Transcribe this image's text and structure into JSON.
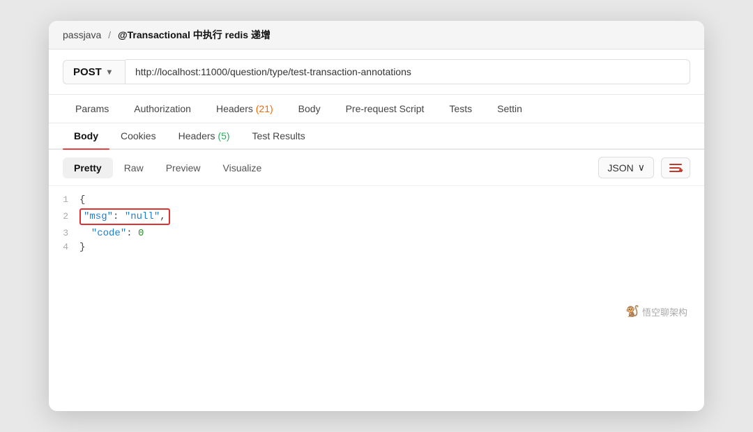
{
  "titlebar": {
    "breadcrumb_base": "passjava",
    "separator": "/",
    "breadcrumb_title": "@Transactional 中执行 redis 递增"
  },
  "url_bar": {
    "method": "POST",
    "chevron": "▾",
    "url": "http://localhost:11000/question/type/test-transaction-annotations"
  },
  "tabs": [
    {
      "id": "params",
      "label": "Params",
      "badge": null,
      "active": false
    },
    {
      "id": "authorization",
      "label": "Authorization",
      "badge": null,
      "active": false
    },
    {
      "id": "headers",
      "label": "Headers",
      "badge": "(21)",
      "active": false
    },
    {
      "id": "body",
      "label": "Body",
      "badge": null,
      "active": false
    },
    {
      "id": "pre-request",
      "label": "Pre-request Script",
      "badge": null,
      "active": false
    },
    {
      "id": "tests",
      "label": "Tests",
      "badge": null,
      "active": false
    },
    {
      "id": "settings",
      "label": "Settin",
      "badge": null,
      "active": false
    }
  ],
  "sub_tabs": [
    {
      "id": "body",
      "label": "Body",
      "badge": null,
      "active": true
    },
    {
      "id": "cookies",
      "label": "Cookies",
      "badge": null,
      "active": false
    },
    {
      "id": "headers",
      "label": "Headers",
      "badge": "(5)",
      "active": false
    },
    {
      "id": "test-results",
      "label": "Test Results",
      "badge": null,
      "active": false
    }
  ],
  "response_toolbar": {
    "tabs": [
      {
        "id": "pretty",
        "label": "Pretty",
        "active": true
      },
      {
        "id": "raw",
        "label": "Raw",
        "active": false
      },
      {
        "id": "preview",
        "label": "Preview",
        "active": false
      },
      {
        "id": "visualize",
        "label": "Visualize",
        "active": false
      }
    ],
    "format": "JSON",
    "format_chevron": "∨",
    "wrap_icon": "⇌"
  },
  "code_lines": [
    {
      "num": "1",
      "content_type": "brace_open"
    },
    {
      "num": "2",
      "content_type": "msg_line",
      "key": "\"msg\"",
      "colon": ":",
      "value": "\"null\"",
      "comma": ","
    },
    {
      "num": "3",
      "content_type": "code_line",
      "key": "\"code\"",
      "colon": ":",
      "value": "0"
    },
    {
      "num": "4",
      "content_type": "brace_close"
    }
  ],
  "watermark": "悟空聊架构"
}
